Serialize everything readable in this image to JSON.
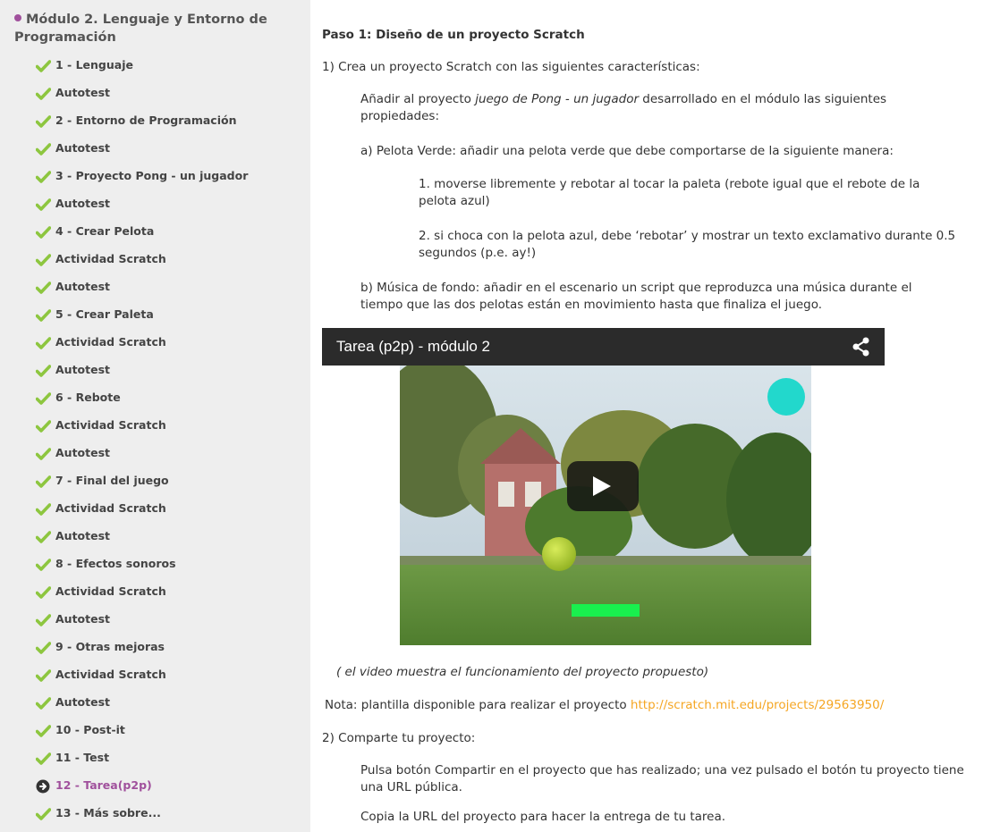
{
  "sidebar": {
    "module_title": "Módulo 2. Lenguaje y Entorno de Programación",
    "items": [
      {
        "label": "1 - Lenguaje",
        "status": "done"
      },
      {
        "label": "Autotest",
        "status": "done"
      },
      {
        "label": "2 - Entorno de Programación",
        "status": "done"
      },
      {
        "label": "Autotest",
        "status": "done"
      },
      {
        "label": "3 - Proyecto Pong - un jugador",
        "status": "done"
      },
      {
        "label": "Autotest",
        "status": "done"
      },
      {
        "label": "4 - Crear Pelota",
        "status": "done"
      },
      {
        "label": "Actividad Scratch",
        "status": "done"
      },
      {
        "label": "Autotest",
        "status": "done"
      },
      {
        "label": "5 - Crear Paleta",
        "status": "done"
      },
      {
        "label": "Actividad Scratch",
        "status": "done"
      },
      {
        "label": "Autotest",
        "status": "done"
      },
      {
        "label": "6 - Rebote",
        "status": "done"
      },
      {
        "label": "Actividad Scratch",
        "status": "done"
      },
      {
        "label": "Autotest",
        "status": "done"
      },
      {
        "label": "7 - Final del juego",
        "status": "done"
      },
      {
        "label": "Actividad Scratch",
        "status": "done"
      },
      {
        "label": "Autotest",
        "status": "done"
      },
      {
        "label": "8 - Efectos sonoros",
        "status": "done"
      },
      {
        "label": "Actividad Scratch",
        "status": "done"
      },
      {
        "label": "Autotest",
        "status": "done"
      },
      {
        "label": "9 - Otras mejoras",
        "status": "done"
      },
      {
        "label": "Actividad Scratch",
        "status": "done"
      },
      {
        "label": "Autotest",
        "status": "done"
      },
      {
        "label": "10 - Post-it",
        "status": "done"
      },
      {
        "label": "11 - Test",
        "status": "done"
      },
      {
        "label": "12 - Tarea(p2p)",
        "status": "current"
      },
      {
        "label": "13 - Más sobre...",
        "status": "done"
      }
    ],
    "colors": {
      "check": "#8dc63f",
      "current": "#a0509c",
      "background": "#eeeeee"
    }
  },
  "content": {
    "step_title": "Paso 1: Diseño de un proyecto Scratch",
    "item1": "1) Crea un proyecto Scratch con las siguientes características:",
    "intro_pre": "Añadir al proyecto ",
    "intro_em": "juego de Pong - un jugador",
    "intro_post": " desarrollado en el módulo las siguientes propiedades:",
    "a": "a) Pelota Verde: añadir una pelota verde que debe comportarse de la siguiente manera:",
    "a1": "1. moverse libremente y rebotar al tocar la paleta (rebote igual que el rebote de la pelota azul)",
    "a2": "2. si choca con la pelota azul, debe ‘rebotar’ y mostrar un texto exclamativo durante 0.5 segundos (p.e. ay!)",
    "b": "b) Música de fondo: añadir en el escenario un script que reproduzca una música durante el tiempo que las dos pelotas están en movimiento hasta que finaliza el juego.",
    "video": {
      "title": "Tarea (p2p) - módulo 2",
      "icons": [
        "share-icon",
        "play-icon"
      ]
    },
    "caption": "( el video muestra el funcionamiento del proyecto propuesto)",
    "note_text": "Nota: plantilla disponible para realizar el proyecto ",
    "note_link": "http://scratch.mit.edu/projects/29563950/",
    "item2": "2) Comparte tu proyecto:",
    "share1": "Pulsa botón Compartir en el proyecto que has  realizado; una vez pulsado el botón tu proyecto tiene una URL pública.",
    "share2": "Copia la URL del proyecto para hacer la entrega de tu tarea.",
    "link_color": "#f5a623"
  }
}
